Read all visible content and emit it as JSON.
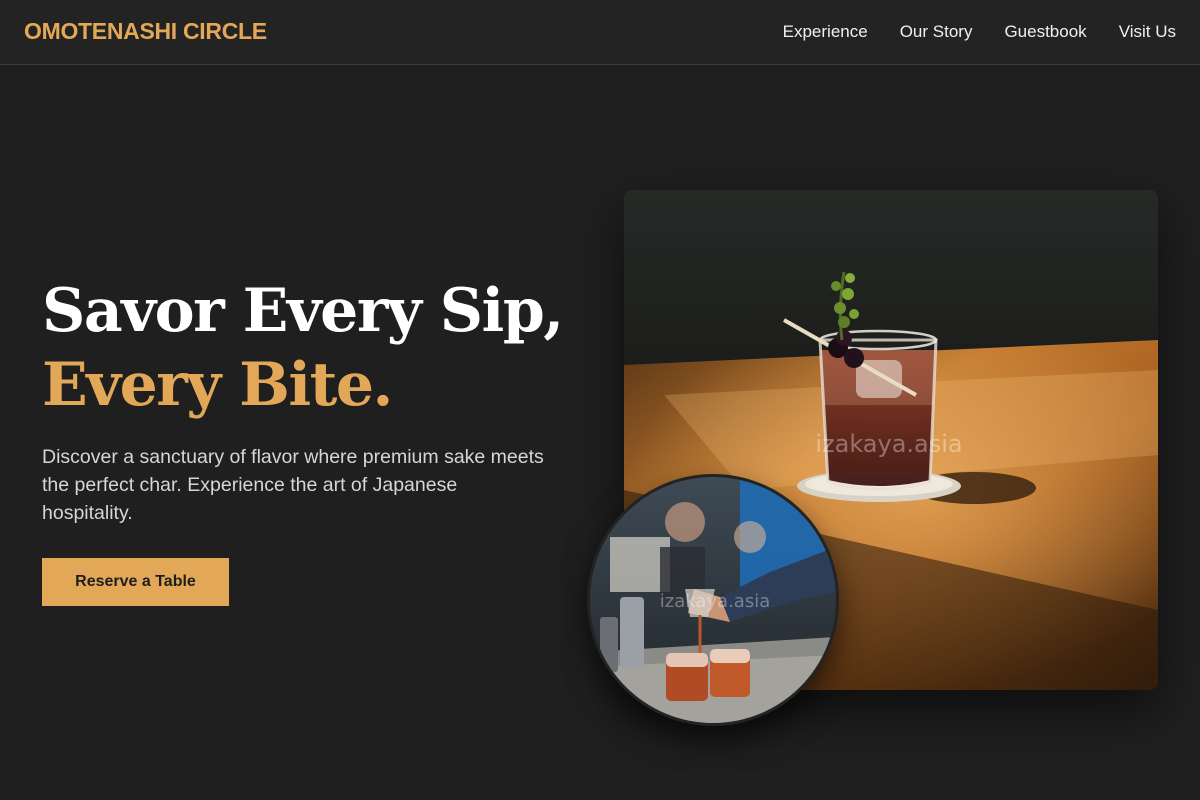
{
  "brand": {
    "name": "OMOTENASHI CIRCLE"
  },
  "nav": {
    "items": [
      {
        "label": "Experience"
      },
      {
        "label": "Our Story"
      },
      {
        "label": "Guestbook"
      },
      {
        "label": "Visit Us"
      }
    ]
  },
  "hero": {
    "headline_line1": "Savor Every Sip,",
    "headline_line2": "Every Bite.",
    "description": "Discover a sanctuary of flavor where premium sake meets the perfect char. Experience the art of Japanese hospitality.",
    "cta_label": "Reserve a Table"
  },
  "images": {
    "main_watermark": "izakaya.asia",
    "round_watermark": "izakaya.asia"
  },
  "colors": {
    "accent": "#e3a857",
    "background": "#1f1f1f",
    "header": "#232323",
    "text": "#ffffff"
  }
}
